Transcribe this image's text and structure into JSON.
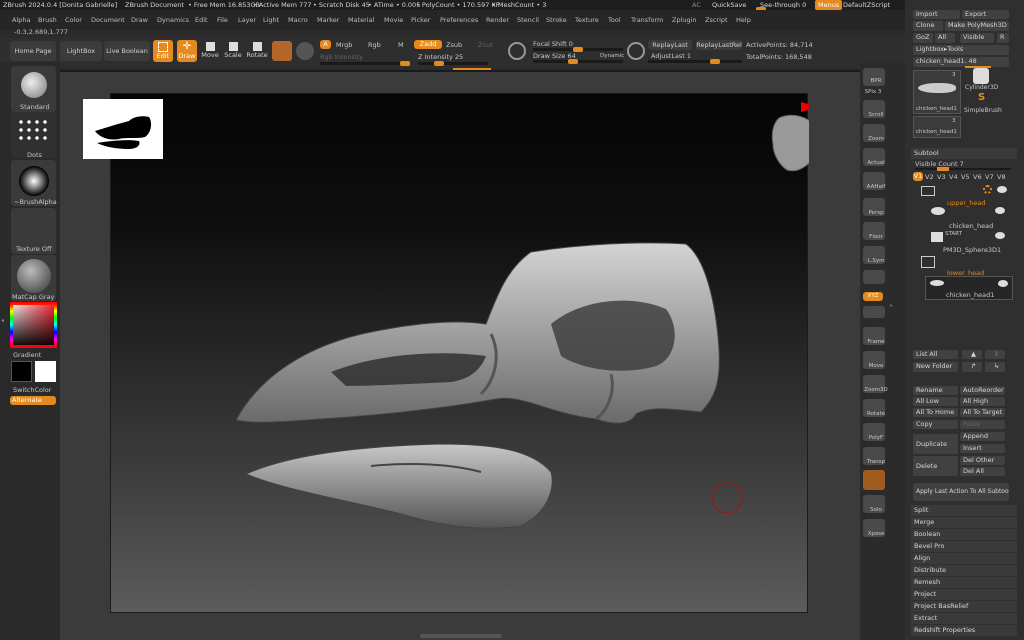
{
  "titlebar": {
    "app": "ZBrush 2024.0.4 [Donita Gabrielle]",
    "document": "ZBrush Document",
    "free_mem": "• Free Mem 16.853GB",
    "active_mem": "• Active Mem 777",
    "scratch": "• Scratch Disk 45",
    "atime": "• ATime • 0.005",
    "polycount": "• PolyCount • 170.597 KP",
    "meshcount": "• MeshCount • 3",
    "ac": "AC",
    "quicksave": "QuickSave",
    "seethrough": "See-through  0",
    "menus": "Menus",
    "script": "DefaultZScript"
  },
  "menu": [
    "Alpha",
    "Brush",
    "Color",
    "Document",
    "Draw",
    "Dynamics",
    "Edit",
    "File",
    "Layer",
    "Light",
    "Macro",
    "Marker",
    "Material",
    "Movie",
    "Picker",
    "Preferences",
    "Render",
    "Stencil",
    "Stroke",
    "Texture",
    "Tool",
    "Transform",
    "Zplugin",
    "Zscript",
    "Help"
  ],
  "coords": "-0.3,2.689,1.777",
  "toolbar": {
    "home": "Home Page",
    "lightbox": "LightBox",
    "live_boolean": "Live Boolean",
    "edit": "Edit",
    "draw": "Draw",
    "move": "Move",
    "scale": "Scale",
    "rotate": "Rotate",
    "a": "A",
    "mrgb": "Mrgb",
    "rgb": "Rgb",
    "m": "M",
    "zadd": "Zadd",
    "zsub": "Zsub",
    "zcut": "Zcut",
    "rgb_intensity": "Rgb Intensity",
    "z_intensity": "Z Intensity 25",
    "focal_shift": "Focal Shift 0",
    "draw_size": "Draw Size 64",
    "dynamic": "Dynamic",
    "replay_last": "ReplayLast",
    "replay_last_rel": "ReplayLastRel",
    "adjust_last": "AdjustLast  1",
    "active_points": "ActivePoints: 84,714",
    "total_points": "TotalPoints: 168,548"
  },
  "left_shelf": {
    "standard": "Standard",
    "dots": "Dots",
    "brush_alpha": "~BrushAlpha",
    "texture_off": "Texture Off",
    "matcap": "MatCap Gray",
    "gradient": "Gradient",
    "switch_color": "SwitchColor",
    "alternate": "Alternate"
  },
  "right_shelf": [
    "BPR",
    "SPix 3",
    "Scroll",
    "Zoom",
    "Actual",
    "AAHalf",
    "Persp",
    "Floor",
    "L.Sym",
    "",
    "XYZ",
    "",
    "Frame",
    "Move",
    "Zoom3D",
    "Rotate",
    "PolyF",
    "Transp",
    "",
    "Solo",
    "Xpose"
  ],
  "tray": {
    "import": "Import",
    "export": "Export",
    "clone": "Clone",
    "make_polymesh": "Make PolyMesh3D",
    "goz": "GoZ",
    "all": "All",
    "visible": "Visible",
    "r": "R",
    "lightbox_tools": "Lightbox▸Tools",
    "current_tool": "chicken_head1. 48",
    "thumb1": "chicken_head1",
    "thumb1_count": "3",
    "cylinder": "Cylinder3D",
    "simplebrush": "SimpleBrush",
    "thumb2": "chicken_head1",
    "thumb2_count": "3",
    "subtool": "Subtool",
    "visible_count": "Visible Count 7",
    "versions": [
      "V1",
      "V2",
      "V3",
      "V4",
      "V5",
      "V6",
      "V7",
      "V8"
    ],
    "folder1": "upper_head",
    "item1": "chicken_head",
    "item2": "PM3D_Sphere3D1",
    "folder2": "lower_head",
    "item3": "chicken_head1",
    "start": "START",
    "list_all": "List All",
    "new_folder": "New Folder",
    "rename": "Rename",
    "auto_reorder": "AutoReorder",
    "all_low": "All Low",
    "all_high": "All High",
    "all_to_home": "All To Home",
    "all_to_target": "All To Target",
    "copy": "Copy",
    "paste": "Paste",
    "duplicate": "Duplicate",
    "append": "Append",
    "insert": "Insert",
    "delete": "Delete",
    "del_other": "Del Other",
    "del_all": "Del All",
    "apply_last": "Apply Last Action To All Subtools",
    "sections": [
      "Split",
      "Merge",
      "Boolean",
      "Bevel Pro",
      "Align",
      "Distribute",
      "Remesh",
      "Project",
      "Project BasRelief",
      "Extract",
      "Redshift Properties"
    ]
  },
  "colors": {
    "accent": "#e58a1e",
    "panel": "#2f2f2f",
    "button": "#414141"
  }
}
